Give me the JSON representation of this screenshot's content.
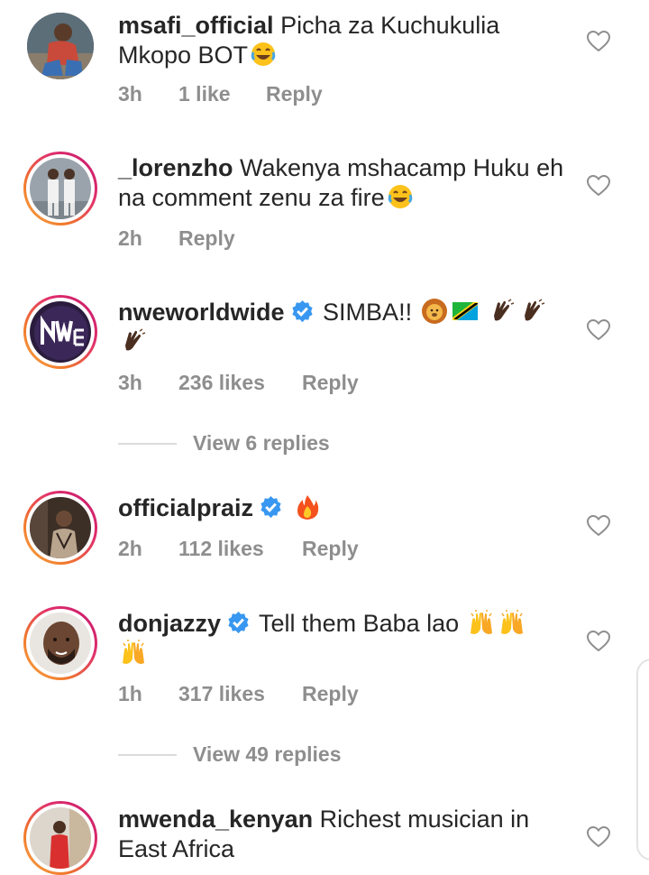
{
  "comments": [
    {
      "username": "msafi_official",
      "text": "Picha za Kuchukulia Mkopo BOT",
      "emoji": [
        "joy"
      ],
      "time": "3h",
      "likes": "1 like",
      "reply": "Reply",
      "verified": false
    },
    {
      "username": "_lorenzho",
      "text": "Wakenya mshacamp Huku eh na comment zenu za fire",
      "emoji": [
        "joy"
      ],
      "time": "2h",
      "likes": "",
      "reply": "Reply",
      "verified": false
    },
    {
      "username": "nweworldwide",
      "text": "SIMBA!!",
      "emoji": [
        "lion",
        "flag-tanzania",
        "clapping-hands",
        "clapping-hands",
        "clapping-hands"
      ],
      "time": "3h",
      "likes": "236 likes",
      "reply": "Reply",
      "verified": true,
      "view_replies": "View 6 replies"
    },
    {
      "username": "officialpraiz",
      "text": "",
      "emoji": [
        "fire"
      ],
      "time": "2h",
      "likes": "112 likes",
      "reply": "Reply",
      "verified": true
    },
    {
      "username": "donjazzy",
      "text": "Tell them Baba lao",
      "emoji": [
        "raising-hands",
        "raising-hands",
        "raising-hands"
      ],
      "time": "1h",
      "likes": "317 likes",
      "reply": "Reply",
      "verified": true,
      "view_replies": "View 49 replies"
    },
    {
      "username": "mwenda_kenyan",
      "text": "Richest musician in East Africa",
      "emoji": [],
      "verified": false
    }
  ],
  "colors": {
    "text": "#262626",
    "secondary": "#8e8e8e",
    "verified": "#3897f0",
    "divider": "#dbdbdb"
  }
}
